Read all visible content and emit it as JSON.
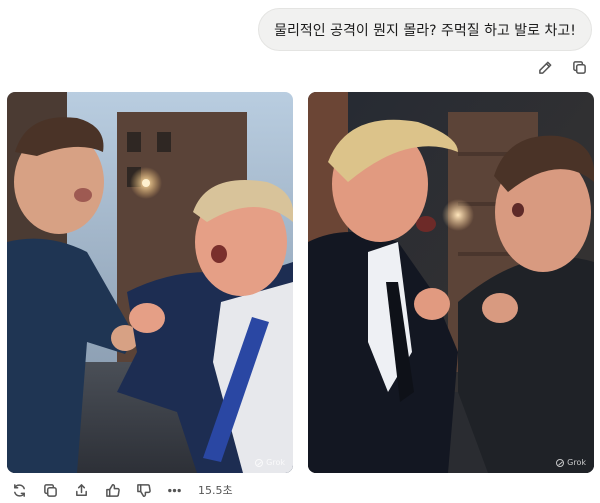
{
  "user_message": {
    "text": "물리적인 공격이 뭔지 몰라? 주먹질 하고 발로 차고!"
  },
  "message_actions": [
    {
      "name": "edit",
      "icon": "pencil-icon"
    },
    {
      "name": "copy",
      "icon": "copy-icon"
    }
  ],
  "images": [
    {
      "watermark": "Grok"
    },
    {
      "watermark": "Grok"
    }
  ],
  "response_actions": {
    "icons": [
      "regenerate-icon",
      "copy-icon",
      "share-icon",
      "thumbs-up-icon",
      "thumbs-down-icon",
      "more-icon"
    ],
    "elapsed": "15.5초"
  }
}
